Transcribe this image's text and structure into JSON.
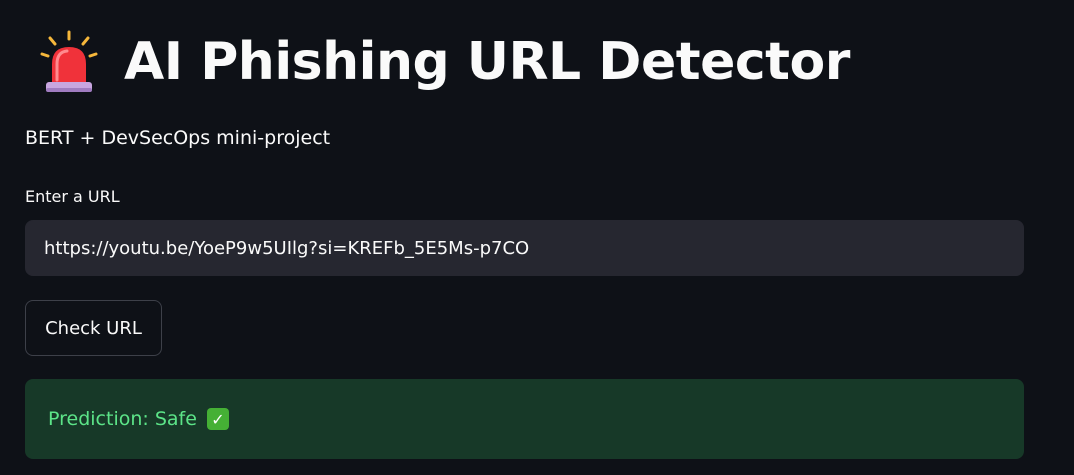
{
  "header": {
    "title": "AI Phishing URL Detector",
    "icon": "siren-icon",
    "subtitle": "BERT + DevSecOps mini-project"
  },
  "form": {
    "url_label": "Enter a URL",
    "url_value": "https://youtu.be/YoeP9w5UIlg?si=KREFb_5E5Ms-p7CO",
    "check_button_label": "Check URL"
  },
  "result": {
    "text": "Prediction: Safe",
    "icon": "check-mark-icon",
    "icon_glyph": "✓",
    "text_color": "#5ce488",
    "background_color": "#173928"
  },
  "theme": {
    "background": "#0e1117",
    "input_background": "#262730",
    "text": "#fafafa"
  }
}
